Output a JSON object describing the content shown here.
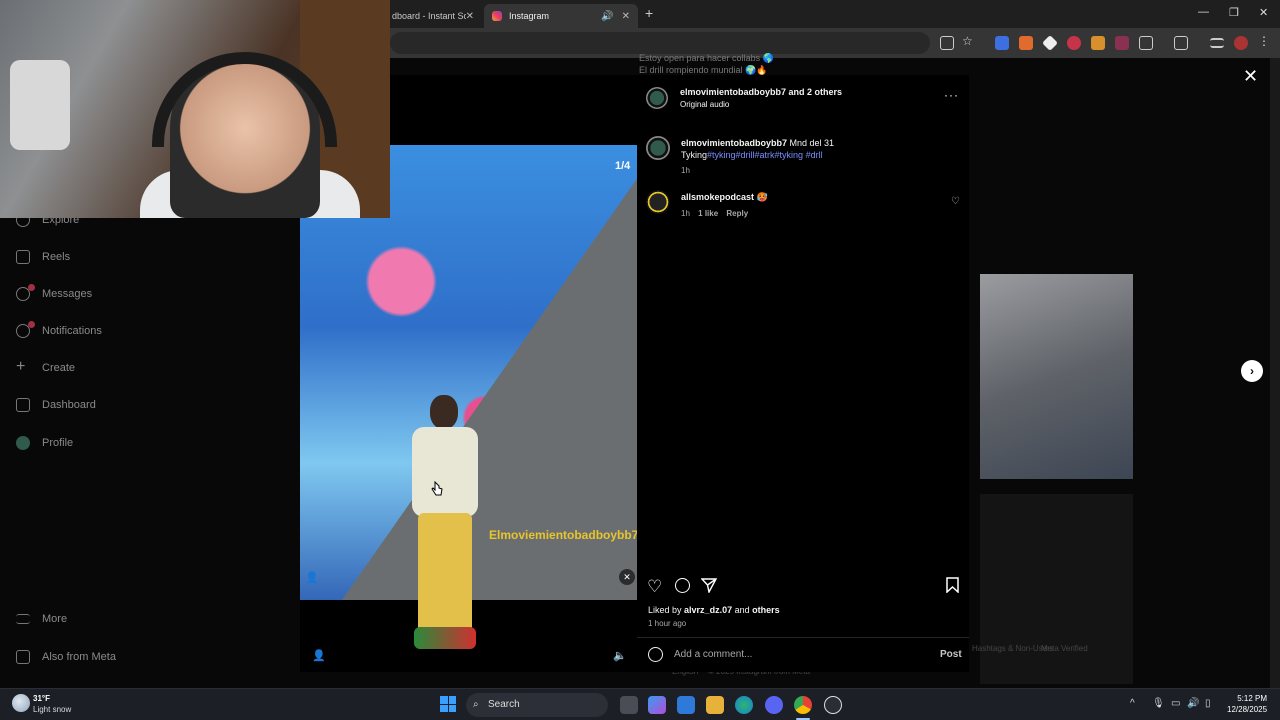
{
  "browser": {
    "tabs": [
      {
        "label": "dboard - Instant So",
        "active": false
      },
      {
        "label": "Instagram",
        "active": true
      }
    ],
    "new_tab": "+",
    "window_controls": {
      "minimize": "—",
      "maximize": "❐",
      "close": "✕"
    }
  },
  "background_page": {
    "sidebar": [
      {
        "label": "Explore"
      },
      {
        "label": "Reels"
      },
      {
        "label": "Messages"
      },
      {
        "label": "Notifications"
      },
      {
        "label": "Create"
      },
      {
        "label": "Dashboard"
      },
      {
        "label": "Profile"
      },
      {
        "label": "More"
      },
      {
        "label": "Also from Meta"
      }
    ],
    "feed_text_1": "Estoy open para hacer collabs 🌎",
    "feed_text_2": "El drill rompiendo mundial 🌍🔥",
    "footer_1": "Hashtags & Non-Users",
    "footer_2": "Meta Verified",
    "footer_3": "English",
    "footer_4": "© 2025 Instagram from Meta"
  },
  "modal": {
    "close": "✕",
    "media": {
      "counter": "1/4",
      "watermark": "Elmoviemientobadboybb7"
    },
    "header": {
      "username": "elmovimientobadboybb7",
      "and_others": "and 2 others",
      "audio": "Original audio",
      "more": "···"
    },
    "caption": {
      "username": "elmovimientobadboybb7",
      "text": "Mnd del 31",
      "line2_plain": "Tyking",
      "hashtags": "#tyking#drill#atrk#tyking #drll",
      "time": "1h"
    },
    "comment": {
      "username": "allsmokepodcast",
      "emoji": "🥵",
      "time": "1h",
      "likes": "1 like",
      "reply": "Reply"
    },
    "liked_by_prefix": "Liked by",
    "liked_by_user": "alvrz_dz.07",
    "liked_by_suffix": "and",
    "liked_by_others": "others",
    "timestamp": "1 hour ago",
    "comment_placeholder": "Add a comment...",
    "post_label": "Post",
    "next": "›"
  },
  "taskbar": {
    "weather_temp": "31°F",
    "weather_cond": "Light snow",
    "search_label": "Search",
    "time": "5:12 PM",
    "date": "12/28/2025"
  }
}
